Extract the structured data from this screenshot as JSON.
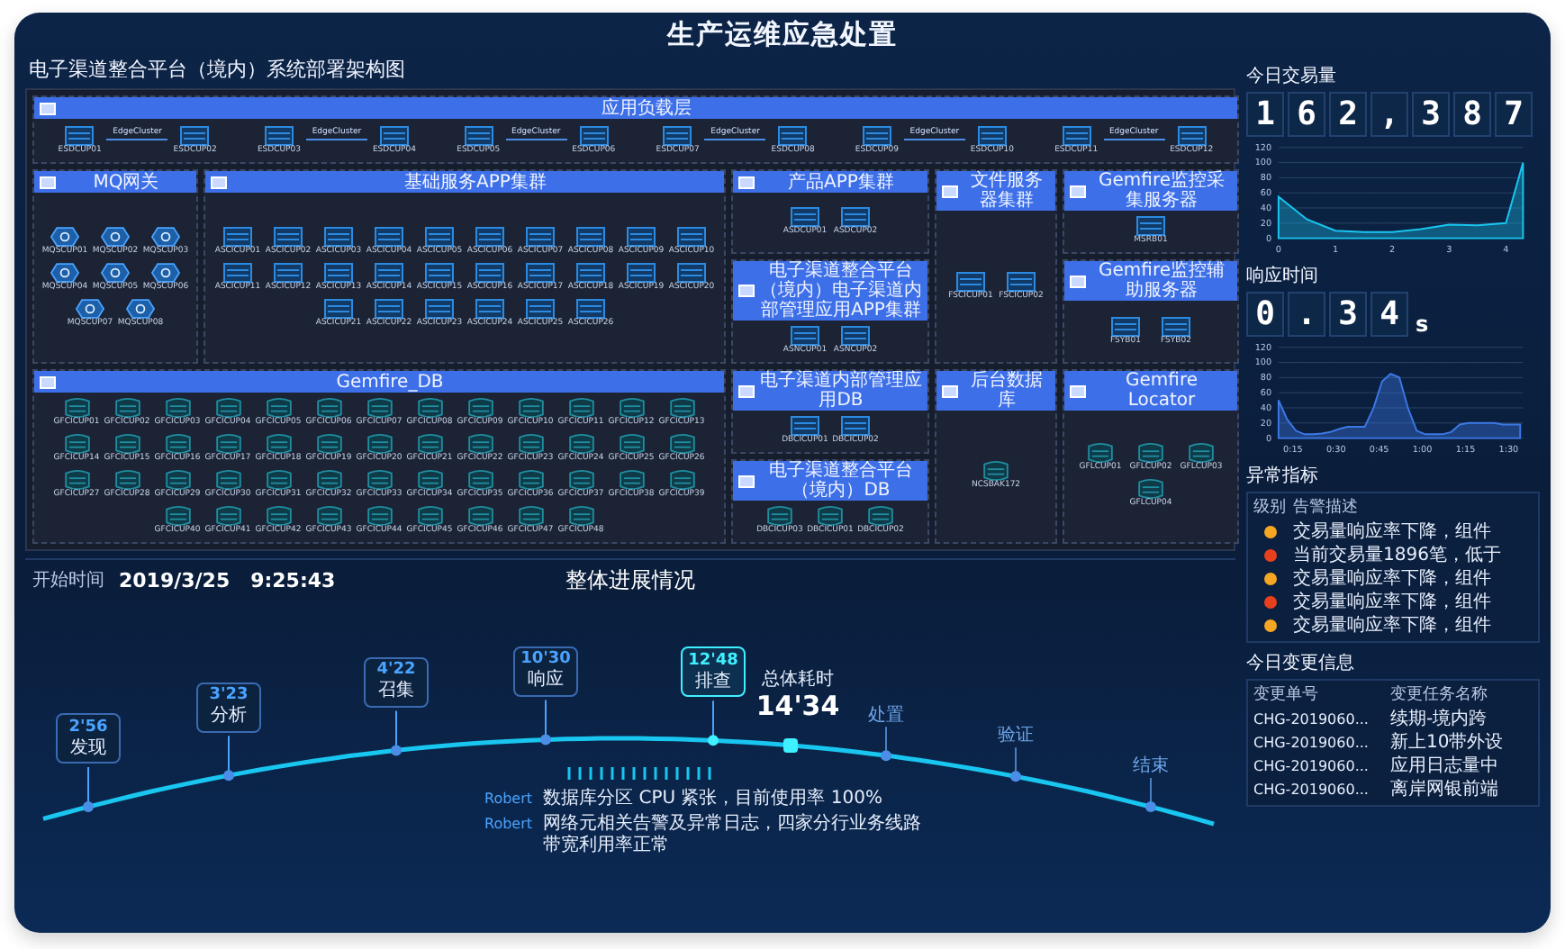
{
  "header": {
    "title": "生产运维应急处置"
  },
  "architecture": {
    "title": "电子渠道整合平台（境内）系统部署架构图",
    "app_layer": {
      "title": "应用负载层",
      "pairs": [
        {
          "left": "ESDCUP01",
          "right": "ESDCUP02",
          "link": "EdgeCluster"
        },
        {
          "left": "ESDCUP03",
          "right": "ESDCUP04",
          "link": "EdgeCluster"
        },
        {
          "left": "ESDCUP05",
          "right": "ESDCUP06",
          "link": "EdgeCluster"
        },
        {
          "left": "ESDCUP07",
          "right": "ESDCUP08",
          "link": "EdgeCluster"
        },
        {
          "left": "ESDCUP09",
          "right": "ESDCUP10",
          "link": "EdgeCluster"
        },
        {
          "left": "ESDCUP11",
          "right": "ESDCUP12",
          "link": "EdgeCluster"
        }
      ]
    },
    "groups": [
      {
        "title": "MQ网关",
        "kind": "hex",
        "nodes": [
          "MQSCUP01",
          "MQSCUP02",
          "MQSCUP03",
          "MQSCUP04",
          "MQSCUP05",
          "MQSCUP06",
          "MQSCUP07",
          "MQSCUP08"
        ]
      },
      {
        "title": "基础服务APP集群",
        "kind": "server",
        "nodes": [
          "ASCICUP01",
          "ASCICUP02",
          "ASCICUP03",
          "ASCICUP04",
          "ASCICUP05",
          "ASCICUP06",
          "ASCICUP07",
          "ASCICUP08",
          "ASCICUP09",
          "ASCICUP10",
          "ASCICUP11",
          "ASCICUP12",
          "ASCICUP13",
          "ASCICUP14",
          "ASCICUP15",
          "ASCICUP16",
          "ASCICUP17",
          "ASCICUP18",
          "ASCICUP19",
          "ASCICUP20",
          "ASCICUP21",
          "ASCICUP22",
          "ASCICUP23",
          "ASCICUP24",
          "ASCICUP25",
          "ASCICUP26"
        ]
      },
      {
        "title": "产品APP集群",
        "kind": "server",
        "nodes": [
          "ASDCUP01",
          "ASDCUP02"
        ]
      },
      {
        "title": "文件服务器集群",
        "kind": "server",
        "nodes": [
          "FSCICUP01",
          "FSCICUP02"
        ]
      },
      {
        "title": "Gemfire监控采集服务器",
        "kind": "server",
        "nodes": [
          "MSRB01"
        ]
      },
      {
        "title": "电子渠道整合平台（境内）电子渠道内部管理应用APP集群",
        "kind": "server",
        "nodes": [
          "ASNCUP01",
          "ASNCUP02"
        ]
      },
      {
        "title": "Gemfire监控辅助服务器",
        "kind": "server",
        "nodes": [
          "FSYB01",
          "FSYB02"
        ]
      },
      {
        "title": "Gemfire_DB",
        "kind": "db",
        "nodes": [
          "GFCICUP01",
          "GFCICUP02",
          "GFCICUP03",
          "GFCICUP04",
          "GFCICUP05",
          "GFCICUP06",
          "GFCICUP07",
          "GFCICUP08",
          "GFCICUP09",
          "GFCICUP10",
          "GFCICUP11",
          "GFCICUP12",
          "GFCICUP13",
          "GFCICUP14",
          "GFCICUP15",
          "GFCICUP16",
          "GFCICUP17",
          "GFCICUP18",
          "GFCICUP19",
          "GFCICUP20",
          "GFCICUP21",
          "GFCICUP22",
          "GFCICUP23",
          "GFCICUP24",
          "GFCICUP25",
          "GFCICUP26",
          "GFCICUP27",
          "GFCICUP28",
          "GFCICUP29",
          "GFCICUP30",
          "GFCICUP31",
          "GFCICUP32",
          "GFCICUP33",
          "GFCICUP34",
          "GFCICUP35",
          "GFCICUP36",
          "GFCICUP37",
          "GFCICUP38",
          "GFCICUP39",
          "GFCICUP40",
          "GFCICUP41",
          "GFCICUP42",
          "GFCICUP43",
          "GFCICUP44",
          "GFCICUP45",
          "GFCICUP46",
          "GFCICUP47",
          "GFCICUP48"
        ]
      },
      {
        "title": "电子渠道内部管理应用DB",
        "kind": "server",
        "nodes": [
          "DBCICUP01",
          "DBCICUP02"
        ]
      },
      {
        "title": "后台数据库",
        "kind": "db",
        "nodes": [
          "NCSBAK172"
        ]
      },
      {
        "title": "Gemfire Locator",
        "kind": "db",
        "nodes": [
          "GFLCUP01",
          "GFLCUP02",
          "GFLCUP03",
          "GFLCUP04"
        ]
      },
      {
        "title": "电子渠道整合平台（境内）DB",
        "kind": "db",
        "nodes": [
          "DBCICUP03",
          "DBCICUP01",
          "DBCICUP02"
        ]
      }
    ]
  },
  "right": {
    "volume": {
      "title": "今日交易量",
      "digits": [
        "1",
        "6",
        "2",
        ",",
        "3",
        "8",
        "7"
      ],
      "chart_data": {
        "type": "area",
        "x": [
          0,
          0.5,
          1,
          1.5,
          2,
          2.5,
          3,
          3.5,
          4,
          4.3
        ],
        "values": [
          55,
          25,
          10,
          8,
          8,
          12,
          18,
          17,
          20,
          100
        ],
        "xlim": [
          0,
          4.3
        ],
        "ylim": [
          0,
          120
        ],
        "xticks": [
          0,
          1,
          2,
          3,
          4
        ],
        "yticks": [
          0,
          20,
          40,
          60,
          80,
          100,
          120
        ],
        "grid": true
      }
    },
    "response": {
      "title": "响应时间",
      "digits": [
        "0",
        ".",
        "3",
        "4"
      ],
      "unit": "s",
      "chart_data": {
        "type": "area",
        "x": [
          10,
          13,
          16,
          19,
          22,
          25,
          28,
          31,
          34,
          37,
          40,
          43,
          46,
          49,
          52,
          55,
          58,
          61,
          64,
          67,
          70,
          73,
          76,
          79,
          82,
          85,
          88,
          91,
          94
        ],
        "values": [
          50,
          25,
          10,
          5,
          5,
          6,
          8,
          12,
          15,
          15,
          15,
          40,
          75,
          85,
          80,
          40,
          10,
          5,
          5,
          5,
          8,
          18,
          20,
          20,
          20,
          20,
          18,
          18,
          18
        ],
        "xlim": [
          10,
          95
        ],
        "ylim": [
          0,
          120
        ],
        "xticks": [
          {
            "value": 15,
            "label": "0:15"
          },
          {
            "value": 30,
            "label": "0:30"
          },
          {
            "value": 45,
            "label": "0:45"
          },
          {
            "value": 60,
            "label": "1:00"
          },
          {
            "value": 75,
            "label": "1:15"
          },
          {
            "value": 90,
            "label": "1:30"
          }
        ],
        "yticks": [
          0,
          20,
          40,
          60,
          80,
          100,
          120
        ],
        "grid": true
      }
    },
    "alerts": {
      "title": "异常指标",
      "columns": [
        "级别",
        "告警描述"
      ],
      "rows": [
        {
          "color": "#f5a623",
          "text": "交易量响应率下降，组件"
        },
        {
          "color": "#e8401c",
          "text": "当前交易量1896笔，低于"
        },
        {
          "color": "#f5a623",
          "text": "交易量响应率下降，组件"
        },
        {
          "color": "#e8401c",
          "text": "交易量响应率下降，组件"
        },
        {
          "color": "#f5a623",
          "text": "交易量响应率下降，组件"
        }
      ]
    },
    "changes": {
      "title": "今日变更信息",
      "columns": [
        "变更单号",
        "变更任务名称"
      ],
      "rows": [
        {
          "id": "CHG-2019060...",
          "name": "续期-境内跨"
        },
        {
          "id": "CHG-2019060...",
          "name": "新上10带外设"
        },
        {
          "id": "CHG-2019060...",
          "name": "应用日志量中"
        },
        {
          "id": "CHG-2019060...",
          "name": "离岸网银前端"
        }
      ]
    }
  },
  "progress": {
    "start_label": "开始时间",
    "start_time": "2019/3/25   9:25:43",
    "title": "整体进展情况",
    "milestones": [
      {
        "time": "2'56",
        "label": "发现",
        "kind": "done"
      },
      {
        "time": "3'23",
        "label": "分析",
        "kind": "done"
      },
      {
        "time": "4'22",
        "label": "召集",
        "kind": "done"
      },
      {
        "time": "10'30",
        "label": "响应",
        "kind": "done"
      },
      {
        "time": "12'48",
        "label": "排查",
        "kind": "current"
      },
      {
        "label": "处置",
        "kind": "pending"
      },
      {
        "label": "验证",
        "kind": "pending"
      },
      {
        "label": "结束",
        "kind": "pending"
      }
    ],
    "total_label": "总体耗时",
    "total": "14'34",
    "logs": [
      {
        "user": "Robert",
        "text": "数据库分区 CPU 紧张，目前使用率 100%"
      },
      {
        "user": "Robert",
        "text": "网络元相关告警及异常日志，四家分行业务线路带宽利用率正常"
      }
    ]
  }
}
